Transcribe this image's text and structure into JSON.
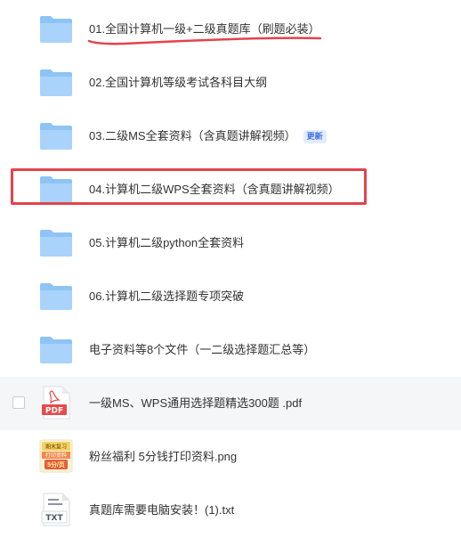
{
  "files": [
    {
      "name": "01.全国计算机一级+二级真题库（刷题必装）",
      "type": "folder"
    },
    {
      "name": "02.全国计算机等级考试各科目大纲",
      "type": "folder"
    },
    {
      "name": "03.二级MS全套资料（含真题讲解视频）",
      "type": "folder",
      "badge": "更新"
    },
    {
      "name": "04.计算机二级WPS全套资料（含真题讲解视频）",
      "type": "folder"
    },
    {
      "name": "05.计算机二级python全套资料",
      "type": "folder"
    },
    {
      "name": "06.计算机二级选择题专项突破",
      "type": "folder"
    },
    {
      "name": "电子资料等8个文件（一二级选择题汇总等）",
      "type": "folder"
    },
    {
      "name": "一级MS、WPS通用选择题精选300题 .pdf",
      "type": "pdf",
      "icon_label": "PDF"
    },
    {
      "name": "粉丝福利 5分钱打印资料.png",
      "type": "png",
      "icon_lines": [
        "期末复习",
        "打印资料",
        "5分/页"
      ]
    },
    {
      "name": "真题库需要电脑安装！(1).txt",
      "type": "txt",
      "icon_label": "TXT"
    }
  ],
  "colors": {
    "folder_back": "#8ec4f5",
    "folder_front": "#a9d3fb",
    "annotation_red": "#e2434e",
    "pdf_red": "#e64a4a",
    "text": "#333333",
    "hover_row": "#f5f6f8"
  },
  "icons": {
    "folder": "folder-icon",
    "pdf": "pdf-file-icon",
    "png": "image-file-icon",
    "txt": "txt-file-icon"
  }
}
